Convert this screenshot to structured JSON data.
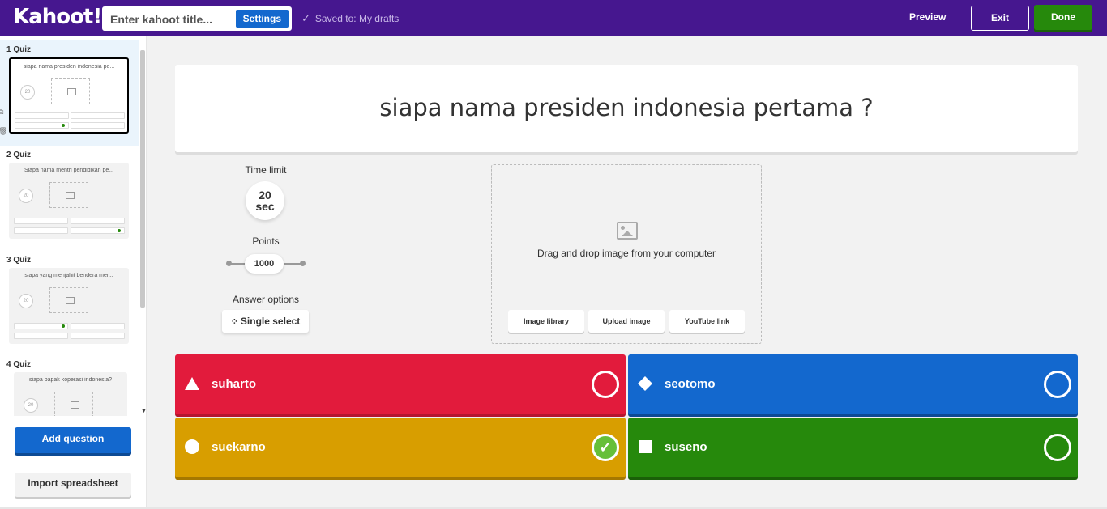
{
  "app": {
    "logo": "Kahoot!"
  },
  "topbar": {
    "title_placeholder": "Enter kahoot title...",
    "settings_label": "Settings",
    "saved_label": "Saved to: My drafts",
    "preview_label": "Preview",
    "exit_label": "Exit",
    "done_label": "Done"
  },
  "sidebar": {
    "slides": [
      {
        "label": "1  Quiz",
        "title": "siapa nama presiden indonesia pe...",
        "timer": "20"
      },
      {
        "label": "2  Quiz",
        "title": "Siapa nama mentri pendidikan pe...",
        "timer": "20"
      },
      {
        "label": "3  Quiz",
        "title": "siapa yang menjahit bendera mer...",
        "timer": "20"
      },
      {
        "label": "4  Quiz",
        "title": "siapa bapak koperasi indonesia?",
        "timer": "20"
      }
    ],
    "add_question_label": "Add question",
    "import_label": "Import spreadsheet"
  },
  "question": {
    "text": "siapa nama presiden indonesia pertama ?"
  },
  "settings": {
    "time_limit_label": "Time limit",
    "time_value": "20",
    "time_unit": "sec",
    "points_label": "Points",
    "points_value": "1000",
    "answer_options_label": "Answer options",
    "answer_options_value": "Single select"
  },
  "media": {
    "prompt": "Drag and drop image from your computer",
    "image_library_label": "Image library",
    "upload_label": "Upload image",
    "youtube_label": "YouTube link"
  },
  "answers": [
    {
      "text": "suharto",
      "shape": "triangle-icon",
      "color": "#e21b3c",
      "correct": false
    },
    {
      "text": "seotomo",
      "shape": "diamond-icon",
      "color": "#1368ce",
      "correct": false
    },
    {
      "text": "suekarno",
      "shape": "circle-icon",
      "color": "#d89e00",
      "correct": true
    },
    {
      "text": "suseno",
      "shape": "square-icon",
      "color": "#26890c",
      "correct": false
    }
  ],
  "colors": {
    "brand": "#46178f",
    "primary": "#1368ce",
    "success": "#26890c"
  }
}
